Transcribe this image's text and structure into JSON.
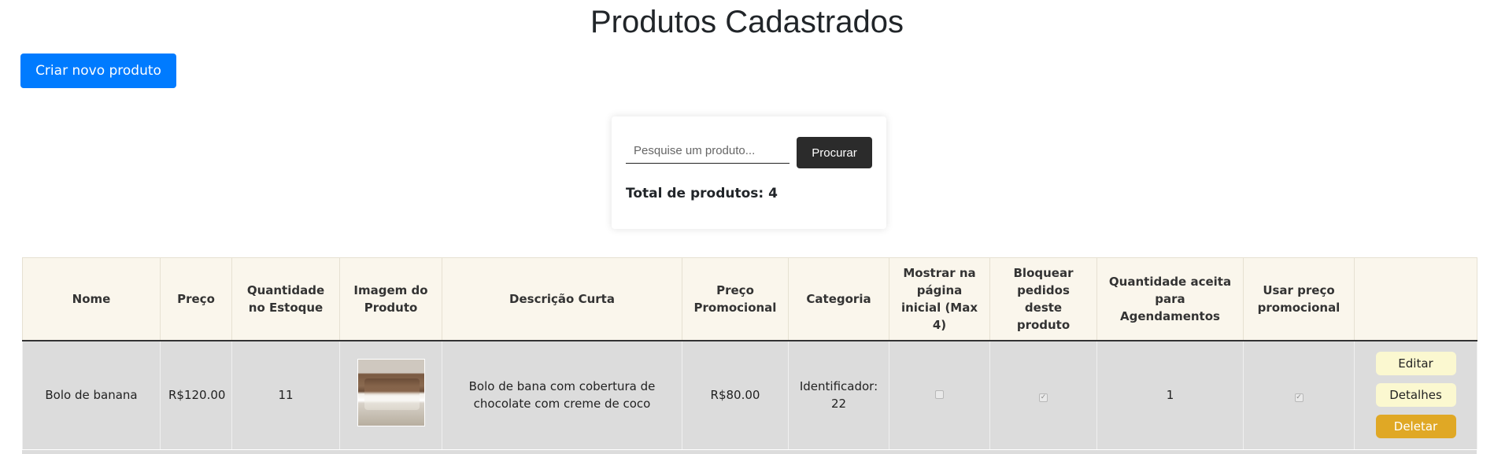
{
  "page": {
    "title": "Produtos Cadastrados"
  },
  "toolbar": {
    "create_label": "Criar novo produto"
  },
  "search": {
    "placeholder": "Pesquise um produto...",
    "button_label": "Procurar",
    "total_text": "Total de produtos: 4"
  },
  "table": {
    "headers": [
      "Nome",
      "Preço",
      "Quantidade no Estoque",
      "Imagem do Produto",
      "Descrição Curta",
      "Preço Promocional",
      "Categoria",
      "Mostrar na página inicial (Max 4)",
      "Bloquear pedidos deste produto",
      "Quantidade aceita para Agendamentos",
      "Usar preço promocional",
      ""
    ],
    "rows": [
      {
        "name": "Bolo de banana",
        "price": "R$120.00",
        "stock": "11",
        "image_icon": "cake-photo",
        "description": "Bolo de bana com cobertura de chocolate com creme de coco",
        "promo_price": "R$80.00",
        "category": "Identificador: 22",
        "show_home": false,
        "block_orders": true,
        "schedule_qty": "1",
        "use_promo": true,
        "actions": {
          "edit": "Editar",
          "details": "Detalhes",
          "delete": "Deletar"
        }
      }
    ]
  },
  "colors": {
    "primary": "#007bff",
    "dark_button": "#2b2b2b",
    "header_bg": "#faf6ec",
    "row_bg": "#dcdcdc",
    "light_action": "#fbf8d0",
    "delete_action": "#e0a825"
  }
}
